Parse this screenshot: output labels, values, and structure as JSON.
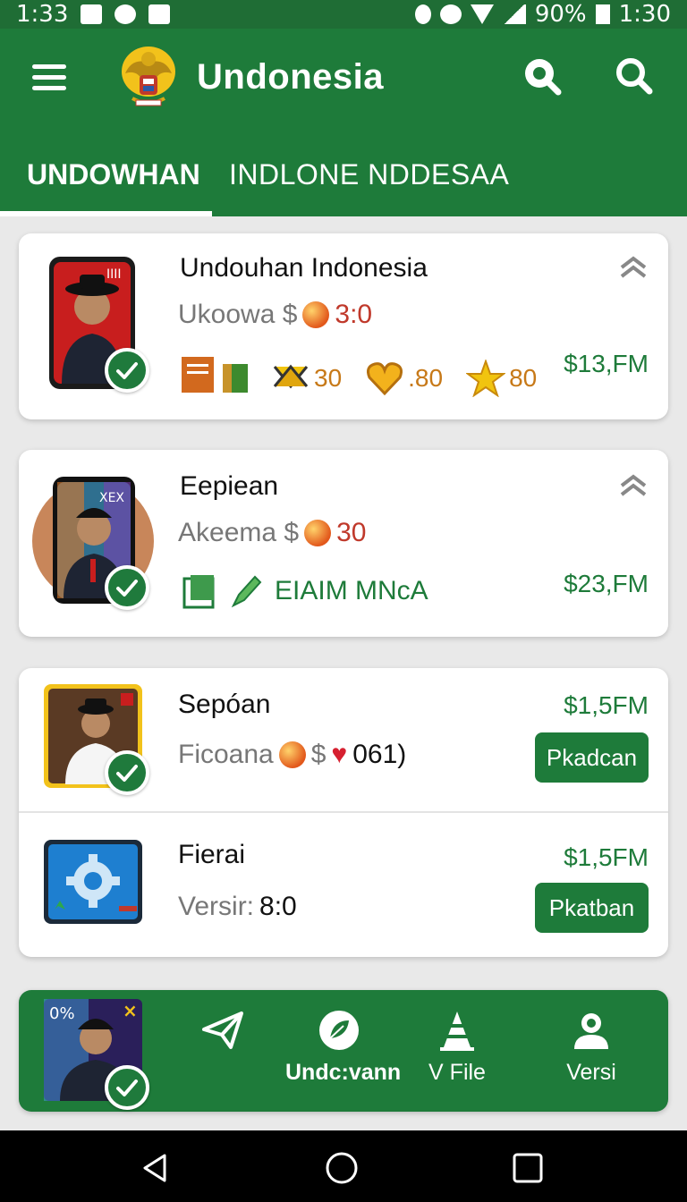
{
  "status_bar": {
    "time_left": "1:33",
    "battery": "90%",
    "time_right": "1:30"
  },
  "app": {
    "title": "Undonesia"
  },
  "tabs": [
    {
      "label": "UNDOWHAN",
      "active": true
    },
    {
      "label": "INDLONE NDDESAA",
      "active": false
    }
  ],
  "cards": [
    {
      "title": "Undouhan Indonesia",
      "subtitle_text": "Ukoowa $",
      "subtitle_value": "3:0",
      "price": "$13,FM",
      "stats": [
        {
          "icon": "ribbon-icon",
          "value": "30"
        },
        {
          "icon": "heart-outline-icon",
          "value": ".80"
        },
        {
          "icon": "star-icon",
          "value": "80"
        }
      ],
      "thumb_label": "IIII"
    },
    {
      "title": "Eepiean",
      "subtitle_text": "Akeema $",
      "subtitle_value": "30",
      "price": "$23,FM",
      "tag_text": "EIAIM MNcA",
      "thumb_label": "XEX"
    }
  ],
  "list_items": [
    {
      "title": "Sepóan",
      "subtitle_text": "Ficoana",
      "subtitle_value": "061)",
      "price": "$1,5FM",
      "button": "Pkadcan"
    },
    {
      "title": "Fierai",
      "subtitle_text": "Versir:",
      "subtitle_value": "8:0",
      "price": "$1,5FM",
      "button": "Pkatban"
    }
  ],
  "bottom_nav": {
    "thumb_label": "0%",
    "items": [
      {
        "label": "",
        "icon": "send-icon"
      },
      {
        "label": "Undc:vann",
        "icon": "leaf-circle-icon"
      },
      {
        "label": "V File",
        "icon": "cone-icon"
      },
      {
        "label": "Versi",
        "icon": "user-icon"
      }
    ]
  },
  "colors": {
    "primary": "#1e7b3a",
    "status_bar": "#1f6d35",
    "accent_red": "#c0392b",
    "background": "#e9e9e9"
  }
}
